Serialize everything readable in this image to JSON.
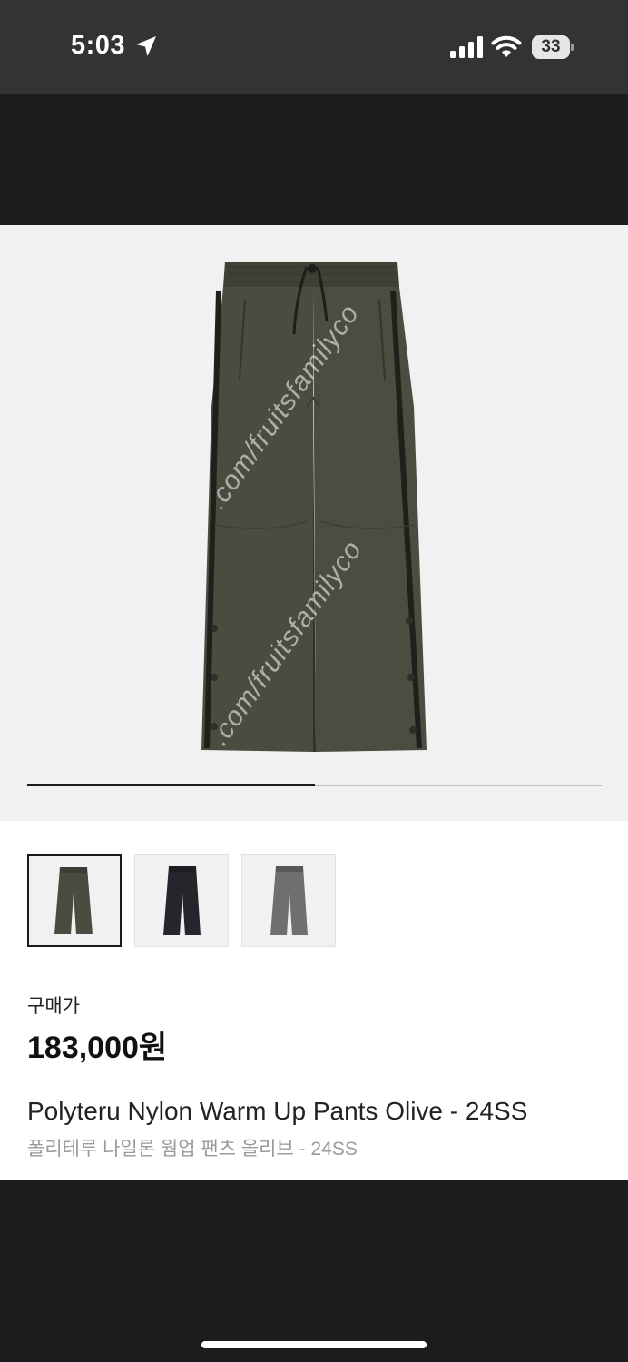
{
  "status_bar": {
    "time": "5:03",
    "battery_level": "33",
    "icons": [
      "location-arrow-icon",
      "cellular-signal-icon",
      "wifi-icon",
      "battery-icon"
    ]
  },
  "hero": {
    "watermark": ".com/fruitsfamilyco",
    "gallery_progress": 0.5,
    "product_color": "#4a4c40"
  },
  "thumbnails": [
    {
      "color_name": "olive",
      "color": "#4a4c40",
      "selected": true
    },
    {
      "color_name": "black",
      "color": "#24262b",
      "selected": false
    },
    {
      "color_name": "grey",
      "color": "#6f6f6f",
      "selected": false
    }
  ],
  "product": {
    "price_label": "구매가",
    "price": "183,000원",
    "name_en": "Polyteru Nylon Warm Up Pants Olive - 24SS",
    "name_ko": "폴리테루 나일론 웜업 팬츠 올리브 - 24SS"
  }
}
